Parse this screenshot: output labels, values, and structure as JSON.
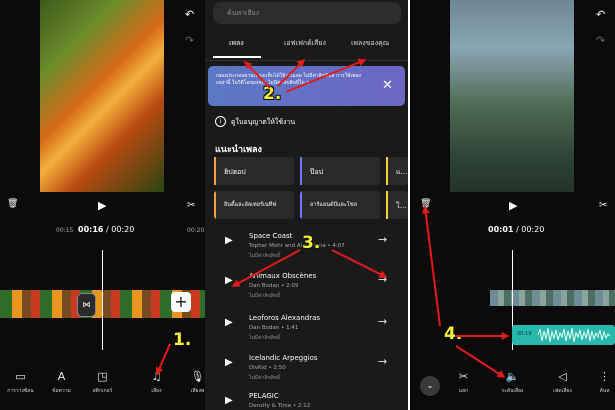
{
  "panel1": {
    "time_start": "00:15",
    "time_current": "00:16",
    "time_sep": " / ",
    "time_total": "00:20",
    "time_end": "00:20",
    "tools": [
      {
        "icon": "picture-in-picture-icon",
        "glyph": "▭",
        "label": "การวางซ้อน"
      },
      {
        "icon": "text-icon",
        "glyph": "A",
        "label": "ข้อความ"
      },
      {
        "icon": "sticker-icon",
        "glyph": "◳",
        "label": "สติกเกอร์"
      },
      {
        "icon": "music-icon",
        "glyph": "♫",
        "label": "เสียง"
      },
      {
        "icon": "microphone-icon",
        "glyph": "🎙",
        "label": "เสียงพ"
      }
    ]
  },
  "panel2": {
    "search_placeholder": "ค้นหาเสียง",
    "tabs": [
      "เพลง",
      "เอฟเฟกต์เสียง",
      "เพลงของคุณ"
    ],
    "banner_text": "เพลงประกอบตามเพลงแท็บได้ใช้งานเลย ไม่มีค่าลิขสิทธิ์ การใช้เพลงเหล่านี้ ในวิดีโอของคุณ ไม่มีค่าลิขสิทธิ์ใด ๆ",
    "license_text": "ดูใบอนุญาตให้ใช้งาน",
    "recs_title": "แนะนำเพลง",
    "categories": [
      {
        "label": "ฮิปฮอป",
        "color": "#f2a23a"
      },
      {
        "label": "ป๊อป",
        "color": "#6f78ff"
      },
      {
        "label": "แ...",
        "color": "#f3d03a"
      },
      {
        "label": "อินดี้และอัลเทอร์เนทีฟ",
        "color": "#f2a23a"
      },
      {
        "label": "อาร์แอนด์บีและโซล",
        "color": "#6f78ff"
      },
      {
        "label": "โ...",
        "color": "#f3d03a"
      }
    ],
    "tracks": [
      {
        "title": "Space Coast",
        "meta": "Topher Mohr and Alex Elena • 4:07",
        "free": "ไม่มีค่าลิขสิทธิ์"
      },
      {
        "title": "Animaux Obscènes",
        "meta": "Dan Bodan • 2:09",
        "free": "ไม่มีค่าลิขสิทธิ์"
      },
      {
        "title": "Leoforos Alexandras",
        "meta": "Dan Bodan • 1:41",
        "free": "ไม่มีค่าลิขสิทธิ์"
      },
      {
        "title": "Icelandic Arpeggios",
        "meta": "DivKid • 2:50",
        "free": "ไม่มีค่าลิขสิทธิ์"
      },
      {
        "title": "PELAGIC",
        "meta": "Density & Time • 2:12",
        "free": ""
      }
    ]
  },
  "panel3": {
    "time_current": "00:01",
    "time_sep": " / ",
    "time_total": "00:20",
    "audio_label": "00:19",
    "tools": [
      {
        "icon": "split-icon",
        "glyph": "✂",
        "label": "แยก"
      },
      {
        "icon": "volume-icon",
        "glyph": "🔈",
        "label": "ระดับเสียง"
      },
      {
        "icon": "fade-icon",
        "glyph": "◁",
        "label": "เฟดเสียง"
      },
      {
        "icon": "more-icon",
        "glyph": "⋮",
        "label": "ค้นห"
      }
    ]
  },
  "annotations": {
    "s1": "1.",
    "s2": "2.",
    "s3": "3.",
    "s4": "4."
  }
}
